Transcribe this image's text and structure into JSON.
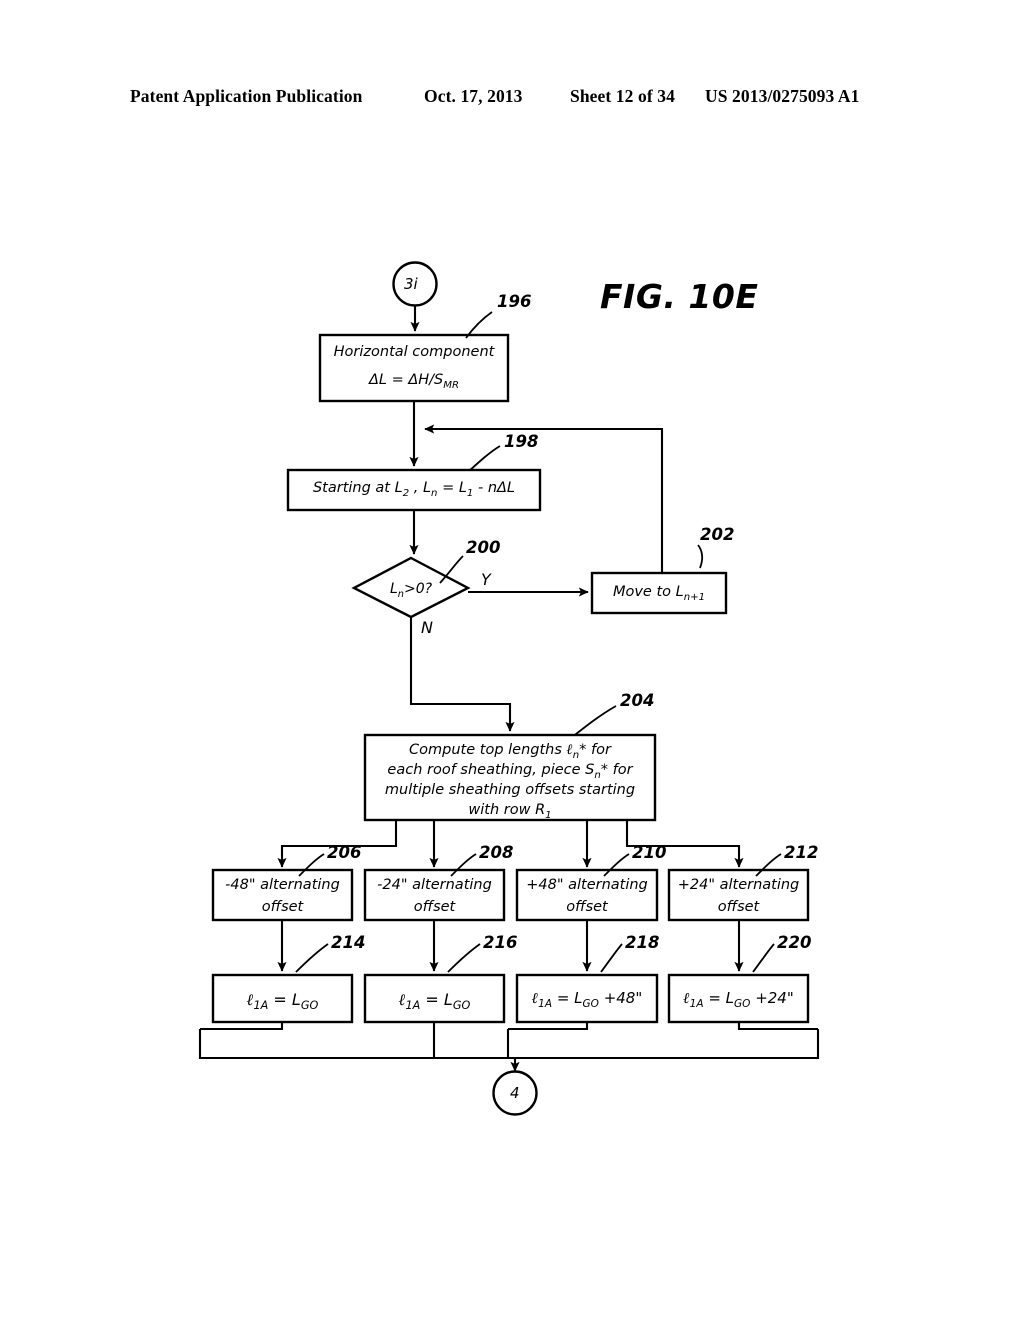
{
  "header": {
    "publication": "Patent Application Publication",
    "date": "Oct. 17, 2013",
    "sheet": "Sheet 12 of 34",
    "patent_number": "US 2013/0275093 A1"
  },
  "figure": {
    "title": "FIG. 10E",
    "type": "flowchart",
    "entry_connector": {
      "label": "3i",
      "name": "entry-connector"
    },
    "exit_connector": {
      "label": "4",
      "name": "exit-connector"
    },
    "nodes": [
      {
        "ref": "196",
        "shape": "process",
        "line1": "Horizontal component",
        "line2_html": "ΔL  = ΔH/S<sub>MR</sub>"
      },
      {
        "ref": "198",
        "shape": "process",
        "text_html": "Starting at L<sub>2</sub> , L<sub>n</sub> = L<sub>1</sub>  - nΔL"
      },
      {
        "ref": "200",
        "shape": "decision",
        "text_html": "L<sub>n</sub>&gt;0?",
        "yes_label": "Y",
        "no_label": "N"
      },
      {
        "ref": "202",
        "shape": "process",
        "text_html": "Move to L<sub>n+1</sub>"
      },
      {
        "ref": "204",
        "shape": "process",
        "line1_html": "Compute top lengths  <span class=\"scr\">ℓ</span><sub>n</sub>* for",
        "line2_html": "each roof sheathing, piece S<sub>n</sub>*  for",
        "line3_html": "multiple sheathing offsets starting",
        "line4_html": "with row R<sub>1</sub>"
      },
      {
        "ref": "206",
        "shape": "process",
        "line1": "-48\" alternating",
        "line2": "offset"
      },
      {
        "ref": "208",
        "shape": "process",
        "line1": "-24\" alternating",
        "line2": "offset"
      },
      {
        "ref": "210",
        "shape": "process",
        "line1": "+48\" alternating",
        "line2": "offset"
      },
      {
        "ref": "212",
        "shape": "process",
        "line1": "+24\" alternating",
        "line2": "offset"
      },
      {
        "ref": "214",
        "shape": "process",
        "text_html": "<span class=\"scr\">ℓ</span><sub>1A</sub> = L<sub>GO</sub>"
      },
      {
        "ref": "216",
        "shape": "process",
        "text_html": "<span class=\"scr\">ℓ</span><sub>1A</sub> = L<sub>GO</sub>"
      },
      {
        "ref": "218",
        "shape": "process",
        "text_html": "<span class=\"scr\">ℓ</span><sub>1A</sub> = L<sub>GO</sub> +48\""
      },
      {
        "ref": "220",
        "shape": "process",
        "text_html": "<span class=\"scr\">ℓ</span><sub>1A</sub> = L<sub>GO</sub> +24\""
      }
    ],
    "colors": {
      "line": "#000000",
      "background": "#ffffff"
    }
  }
}
